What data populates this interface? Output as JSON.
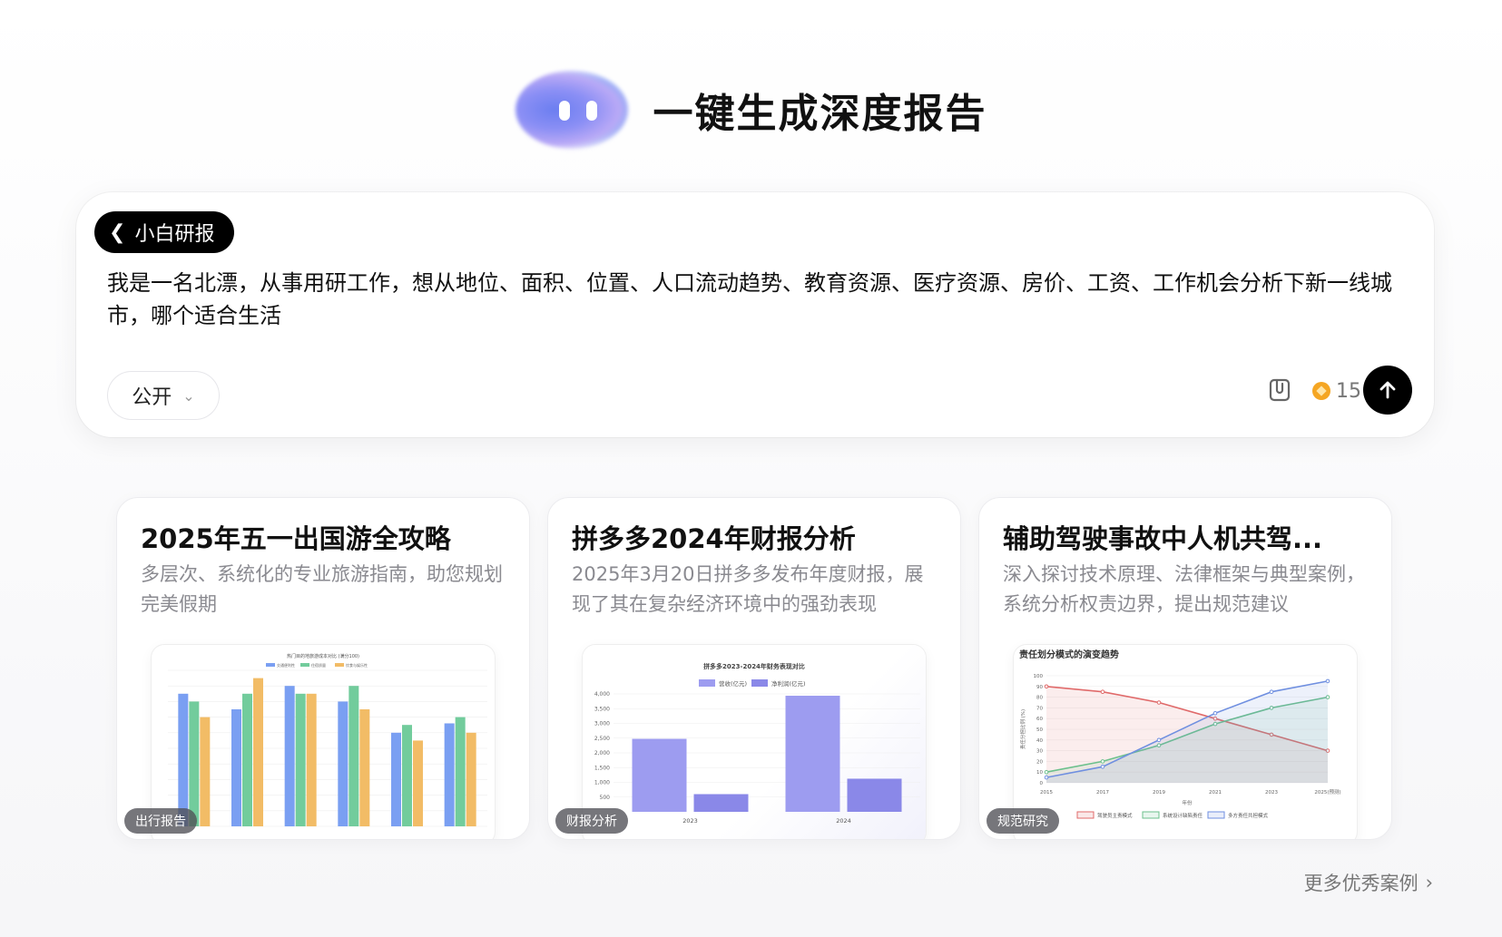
{
  "hero": {
    "title": "一键生成深度报告"
  },
  "prompt": {
    "mode_label": "小白研报",
    "text": "我是一名北漂，从事用研工作，想从地位、面积、位置、人口流动趋势、教育资源、医疗资源、房价、工资、工作机会分析下新一线城市，哪个适合生活",
    "visibility": "公开",
    "credits": "15"
  },
  "cards": [
    {
      "title": "2025年五一出国游全攻略",
      "desc": "多层次、系统化的专业旅游指南，助您规划完美假期",
      "tag": "出行报告",
      "chart_title": "热门目的地旅游成本对比 (满分100)",
      "legend": [
        "交通便利性",
        "住宿质量",
        "饮食与娱乐性"
      ]
    },
    {
      "title": "拼多多2024年财报分析",
      "desc": "2025年3月20日拼多多发布年度财报，展现了其在复杂经济环境中的强劲表现",
      "tag": "财报分析",
      "chart_title": "拼多多2023-2024年财务表现对比",
      "legend": [
        "营收(亿元)",
        "净利润(亿元)"
      ]
    },
    {
      "title": "辅助驾驶事故中人机共驾...",
      "desc": "深入探讨技术原理、法律框架与典型案例，系统分析权责边界，提出规范建议",
      "tag": "规范研究",
      "chart_title": "责任划分模式的演变趋势",
      "legend": [
        "驾驶员主责模式",
        "系统设计缺陷责任",
        "多方责任共担模式"
      ]
    }
  ],
  "chart_data": [
    {
      "type": "bar",
      "title": "热门目的地旅游成本对比 (满分100)",
      "ylim": [
        0,
        100
      ],
      "series": [
        {
          "name": "交通便利性",
          "values": [
            85,
            75,
            90,
            80,
            60,
            66
          ]
        },
        {
          "name": "住宿质量",
          "values": [
            80,
            85,
            85,
            90,
            65,
            70
          ]
        },
        {
          "name": "饮食与娱乐性",
          "values": [
            70,
            95,
            85,
            75,
            55,
            60
          ]
        }
      ],
      "colors": [
        "#7a9ff2",
        "#72cc9c",
        "#f2bc66"
      ]
    },
    {
      "type": "bar",
      "title": "拼多多2023-2024年财务表现对比",
      "categories": [
        "2023",
        "2024"
      ],
      "ylim": [
        0,
        4000
      ],
      "yticks": [
        "4,000",
        "3,500",
        "3,000",
        "2,500",
        "2,000",
        "1,500",
        "1,000",
        "500"
      ],
      "series": [
        {
          "name": "营收(亿元)",
          "values": [
            2476,
            3938
          ]
        },
        {
          "name": "净利润(亿元)",
          "values": [
            600,
            1124
          ]
        }
      ],
      "colors": [
        "#9d9cf0",
        "#8a88e8"
      ]
    },
    {
      "type": "line",
      "title": "责任划分模式的演变趋势",
      "x": [
        "2015",
        "2017",
        "2019",
        "2021",
        "2023",
        "2025(预测)"
      ],
      "xlabel": "年份",
      "ylabel": "责任分担比例 (%)",
      "ylim": [
        0,
        100
      ],
      "series": [
        {
          "name": "驾驶员主责模式",
          "values": [
            90,
            85,
            75,
            60,
            45,
            30
          ]
        },
        {
          "name": "系统设计缺陷责任",
          "values": [
            10,
            20,
            35,
            55,
            70,
            80
          ]
        },
        {
          "name": "多方责任共担模式",
          "values": [
            5,
            15,
            40,
            65,
            85,
            95
          ]
        }
      ],
      "colors": [
        "#e06a6a",
        "#6cc08c",
        "#6f8fe0"
      ]
    }
  ],
  "footer": {
    "more_label": "更多优秀案例"
  }
}
